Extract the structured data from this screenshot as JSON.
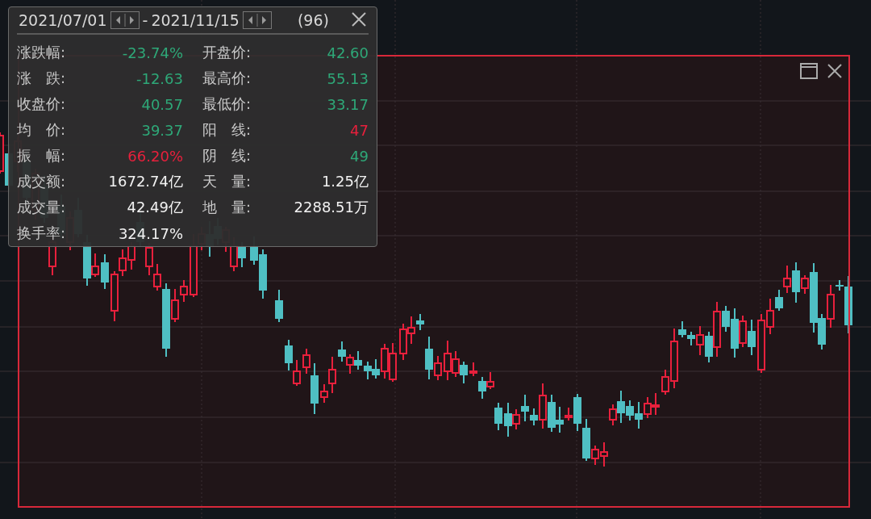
{
  "range_popup": {
    "start_date": "2021/07/01",
    "separator": "-",
    "end_date": "2021/11/15",
    "count": "(96)",
    "left_stats": [
      {
        "label": "涨跌幅:",
        "value": "-23.74%",
        "color": "#2ea878"
      },
      {
        "label": "涨　跌:",
        "value": "-12.63",
        "color": "#2ea878"
      },
      {
        "label": "收盘价:",
        "value": "40.57",
        "color": "#2ea878"
      },
      {
        "label": "均　价:",
        "value": "39.37",
        "color": "#2ea878"
      },
      {
        "label": "振　幅:",
        "value": "66.20%",
        "color": "#e8203c"
      },
      {
        "label": "成交额:",
        "value": "1672.74亿",
        "color": "#f2f2f2"
      },
      {
        "label": "成交量:",
        "value": "42.49亿",
        "color": "#f2f2f2"
      },
      {
        "label": "换手率:",
        "value": "324.17%",
        "color": "#f2f2f2"
      }
    ],
    "right_stats": [
      {
        "label": "开盘价:",
        "value": "42.60",
        "color": "#2ea878"
      },
      {
        "label": "最高价:",
        "value": "55.13",
        "color": "#2ea878"
      },
      {
        "label": "最低价:",
        "value": "33.17",
        "color": "#2ea878"
      },
      {
        "label": "阳　线:",
        "value": "47",
        "color": "#e8203c"
      },
      {
        "label": "阴　线:",
        "value": "49",
        "color": "#2ea878"
      },
      {
        "label": "天　量:",
        "value": "1.25亿",
        "color": "#f2f2f2"
      },
      {
        "label": "地　量:",
        "value": "2288.51万",
        "color": "#f2f2f2"
      }
    ]
  }
}
